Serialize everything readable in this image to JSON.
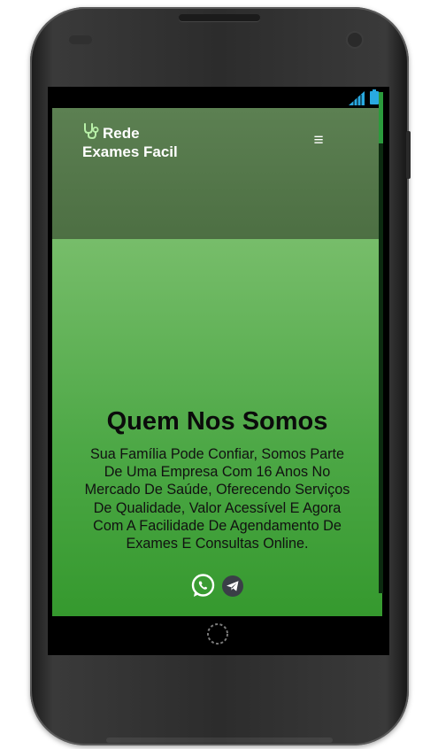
{
  "app": {
    "brand_line1": "Rede",
    "brand_line2": "Exames Facil",
    "brand_icon": "stethoscope-icon",
    "menu_icon": "hamburger-menu-icon",
    "menu_glyph": "≡"
  },
  "hero": {
    "title": "Quem Nos Somos",
    "text": "Sua Família Pode Confiar, Somos Parte De Uma Empresa Com 16 Anos No Mercado De Saúde, Oferecendo Serviços De Qualidade, Valor Acessível E Agora Com A Facilidade De Agendamento De Exames E Consultas Online.",
    "social_icons": [
      "whatsapp-icon",
      "telegram-icon"
    ]
  },
  "status_bar": {
    "icons": [
      "signal-icon",
      "battery-icon"
    ]
  },
  "colors": {
    "navbar": "#557a4b",
    "hero_top": "#77bd6a",
    "hero_bottom": "#35992e",
    "status_icons": "#29a9e0",
    "scroll_thumb": "#2b9a3c"
  }
}
